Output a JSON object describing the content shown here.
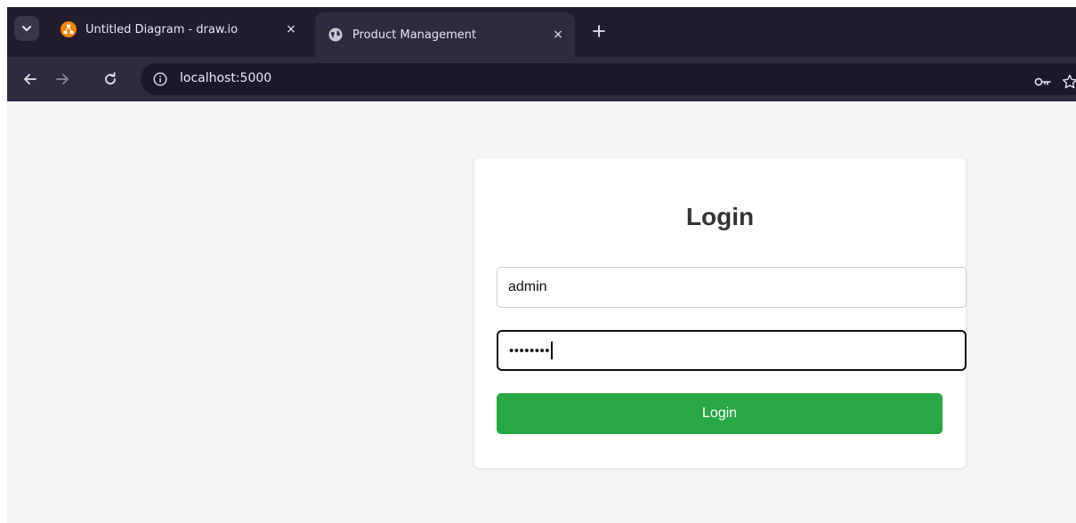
{
  "browser": {
    "tabs": [
      {
        "title": "Untitled Diagram - draw.io",
        "favicon": "drawio-icon",
        "active": false
      },
      {
        "title": "Product Management",
        "favicon": "globe-icon",
        "active": true
      }
    ],
    "close_glyph": "×",
    "new_tab_glyph": "+",
    "url": "localhost:5000"
  },
  "login": {
    "heading": "Login",
    "username_value": "admin",
    "password_value": "••••••••",
    "button_label": "Login"
  },
  "colors": {
    "button": "#28a745",
    "page_bg": "#f4f4f4",
    "chrome_dark": "#211d2f"
  }
}
